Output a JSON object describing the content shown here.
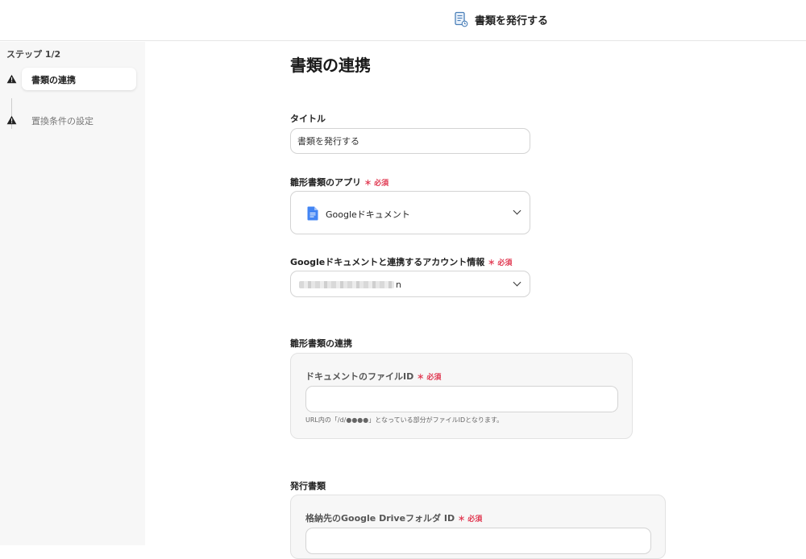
{
  "header": {
    "title": "書類を発行する"
  },
  "sidebar": {
    "step_count": "ステップ 1/2",
    "steps": [
      {
        "label": "書類の連携",
        "state": "active"
      },
      {
        "label": "置換条件の設定",
        "state": "inactive"
      }
    ]
  },
  "main": {
    "page_title": "書類の連携",
    "title_field": {
      "label": "タイトル",
      "value": "書類を発行する"
    },
    "template_app": {
      "label": "雛形書類のアプリ",
      "required": "＊ 必須",
      "value": "Googleドキュメント"
    },
    "account": {
      "label": "Googleドキュメントと連携するアカウント情報",
      "required": "＊ 必須",
      "value_suffix": "n"
    },
    "template_link": {
      "section_label": "雛形書類の連携",
      "file_id_label": "ドキュメントのファイルID",
      "required": "＊ 必須",
      "file_id_value": "",
      "hint": "URL内の「/d/●●●●」となっている部分がファイルIDとなります。"
    },
    "issue_docs": {
      "section_label": "発行書類",
      "folder_label": "格納先のGoogle Driveフォルダ ID",
      "required": "＊ 必須",
      "folder_value": ""
    }
  },
  "colors": {
    "required": "#e0364f",
    "docs_blue": "#4285f4",
    "sidebar_bg": "#f7f7f7"
  },
  "icons": {
    "header": "document-icon",
    "warning": "warning-icon",
    "app": "google-docs-icon",
    "dropdown": "chevron-down-icon"
  }
}
